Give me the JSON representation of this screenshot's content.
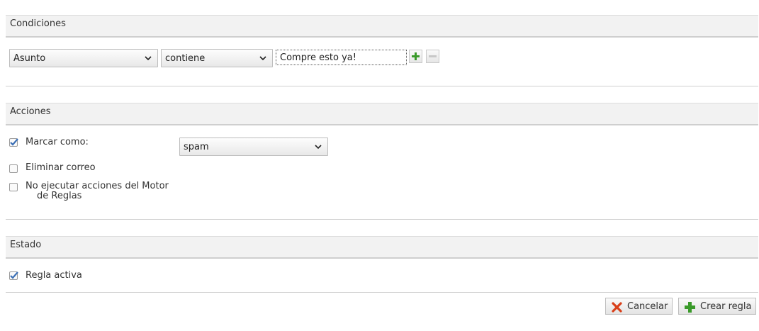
{
  "conditions": {
    "header": "Condiciones",
    "field_select": "Asunto",
    "operator_select": "contiene",
    "value_input": "Compre esto ya!"
  },
  "actions": {
    "header": "Acciones",
    "mark_as": {
      "label": "Marcar como:",
      "checked": true,
      "select_value": "spam"
    },
    "delete_mail": {
      "label": "Eliminar correo",
      "checked": false
    },
    "stop_rules": {
      "label_line1": "No ejecutar acciones del Motor",
      "label_line2": "de Reglas",
      "checked": false
    }
  },
  "status": {
    "header": "Estado",
    "rule_active": {
      "label": "Regla activa",
      "checked": true
    }
  },
  "buttons": {
    "cancel": "Cancelar",
    "create": "Crear regla"
  },
  "icons": {
    "add": "plus-icon",
    "remove": "minus-icon",
    "cancel": "x-icon",
    "create": "plus-icon",
    "check": "checkmark-icon"
  },
  "colors": {
    "plus_green": "#3a9a2a",
    "cancel_red": "#d9401a",
    "check_blue": "#3b6fb5"
  }
}
